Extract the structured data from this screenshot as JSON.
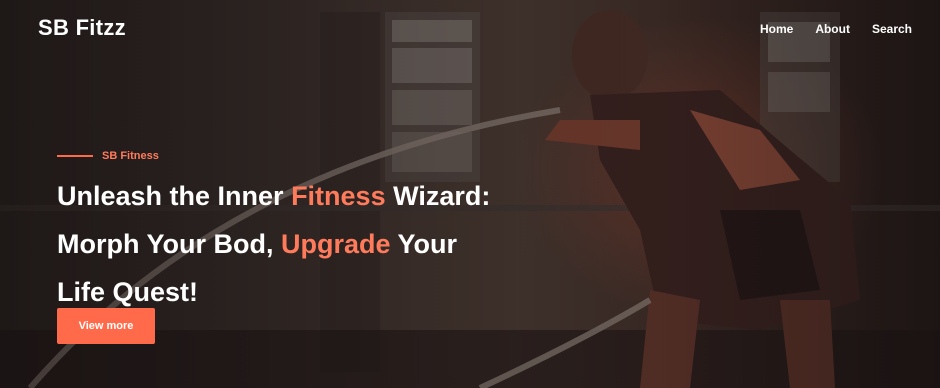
{
  "header": {
    "brand": "SB Fitzz",
    "nav": [
      "Home",
      "About",
      "Search"
    ]
  },
  "hero": {
    "eyebrow": "SB Fitness",
    "headline": {
      "line1_pre": "Unleash the Inner ",
      "line1_accent": "Fitness",
      "line1_post": " Wizard:",
      "line2_pre": "Morph Your Bod, ",
      "line2_accent": "Upgrade",
      "line2_post": " Your",
      "line3": "Life Quest!"
    },
    "cta_label": "View more"
  },
  "colors": {
    "accent": "#ff6b4a",
    "text": "#ffffff",
    "background": "#2b2422"
  },
  "icons": [
    "battle-ropes-photo"
  ]
}
